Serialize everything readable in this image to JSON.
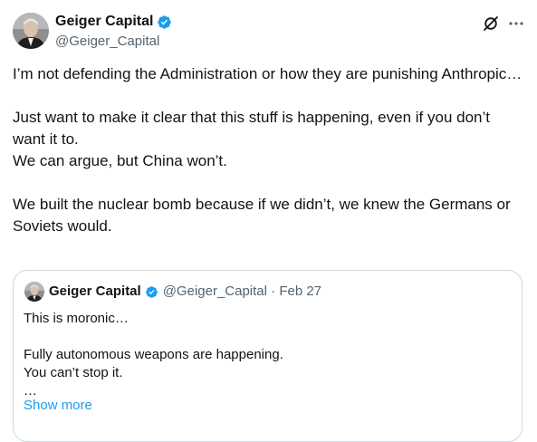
{
  "author": {
    "display_name": "Geiger Capital",
    "handle": "@Geiger_Capital",
    "verified_color": "#1d9bf0"
  },
  "actions": {
    "grok_icon": "grok-icon",
    "more_icon": "more-horizontal-icon"
  },
  "tweet": {
    "lines": [
      "I’m not defending the Administration or how they are punishing Anthropic…",
      "Just want to make it clear that this stuff is happening, even if you don’t want it to.",
      "We can argue, but China won’t.",
      "We built the nuclear bomb because if we didn’t, we knew the Germans or Soviets would."
    ]
  },
  "quoted": {
    "display_name": "Geiger Capital",
    "meta": "@Geiger_Capital · Feb 27",
    "lines": [
      "This is moronic…",
      "Fully autonomous weapons are happening.",
      "You can’t stop it.",
      "…"
    ],
    "show_more": "Show more"
  },
  "colors": {
    "text": "#0f1419",
    "secondary": "#536471",
    "link": "#1d9bf0",
    "border": "#cfd9de"
  }
}
